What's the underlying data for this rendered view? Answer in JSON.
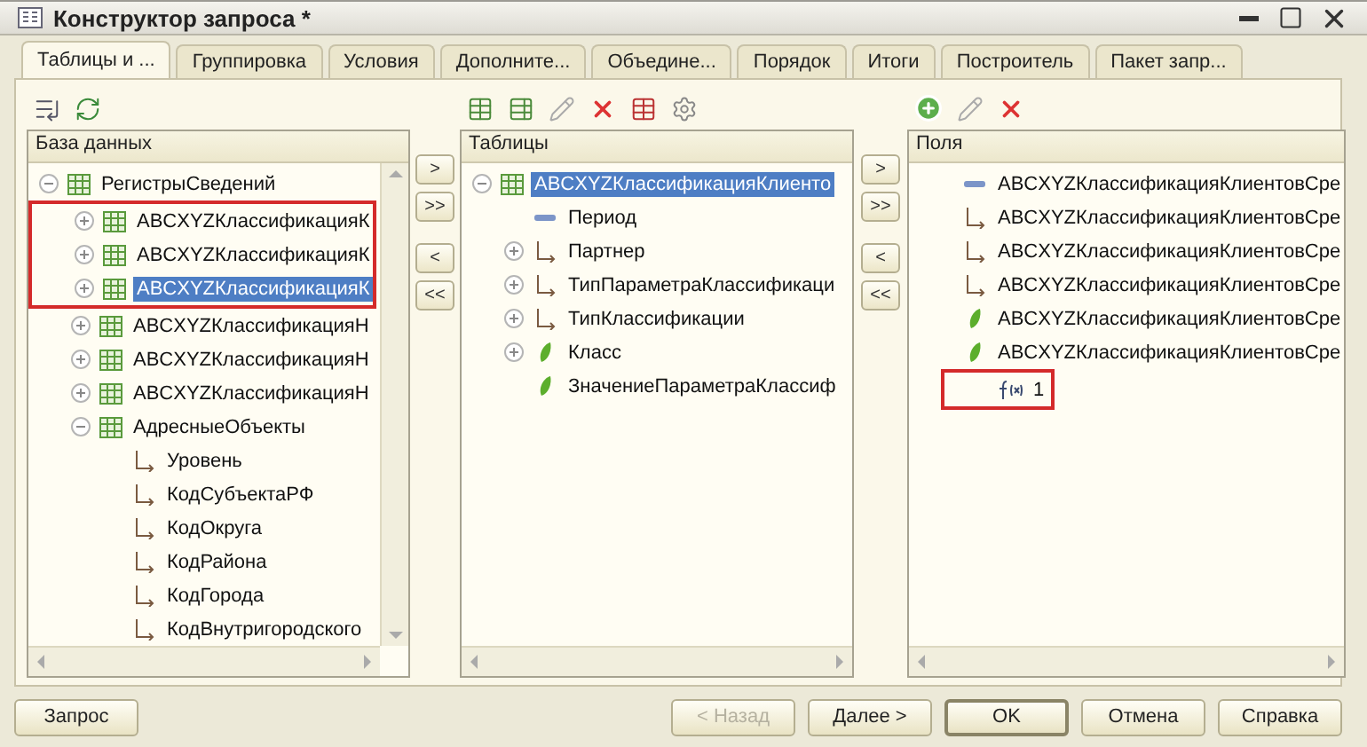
{
  "window": {
    "title": "Конструктор запроса *"
  },
  "tabs": [
    {
      "label": "Таблицы и ...",
      "selected": true
    },
    {
      "label": "Группировка",
      "selected": false
    },
    {
      "label": "Условия",
      "selected": false
    },
    {
      "label": "Дополните...",
      "selected": false
    },
    {
      "label": "Объедине...",
      "selected": false
    },
    {
      "label": "Порядок",
      "selected": false
    },
    {
      "label": "Итоги",
      "selected": false
    },
    {
      "label": "Построитель",
      "selected": false
    },
    {
      "label": "Пакет запр...",
      "selected": false
    }
  ],
  "database_panel": {
    "header": "База данных",
    "items": [
      {
        "label": "РегистрыСведений",
        "kind": "table",
        "expanded": true,
        "selected": false,
        "children": [
          {
            "label": "ABCXYZКлассификацияК",
            "kind": "table",
            "expanded": false,
            "selected": false,
            "marked": true
          },
          {
            "label": "ABCXYZКлассификацияК",
            "kind": "table",
            "expanded": false,
            "selected": false,
            "marked": true
          },
          {
            "label": "ABCXYZКлассификацияК",
            "kind": "table",
            "expanded": false,
            "selected": true,
            "marked": true
          },
          {
            "label": "ABCXYZКлассификацияН",
            "kind": "table",
            "expanded": false,
            "selected": false
          },
          {
            "label": "ABCXYZКлассификацияН",
            "kind": "table",
            "expanded": false,
            "selected": false
          },
          {
            "label": "ABCXYZКлассификацияН",
            "kind": "table",
            "expanded": false,
            "selected": false
          },
          {
            "label": "АдресныеОбъекты",
            "kind": "table",
            "expanded": true,
            "selected": false,
            "children": [
              {
                "label": "Уровень",
                "kind": "reference",
                "selected": false
              },
              {
                "label": "КодСубъектаРФ",
                "kind": "reference",
                "selected": false
              },
              {
                "label": "КодОкруга",
                "kind": "reference",
                "selected": false
              },
              {
                "label": "КодРайона",
                "kind": "reference",
                "selected": false
              },
              {
                "label": "КодГорода",
                "kind": "reference",
                "selected": false
              },
              {
                "label": "КодВнутригородского",
                "kind": "reference",
                "selected": false
              }
            ]
          }
        ]
      }
    ]
  },
  "move_buttons_left": [
    ">",
    ">>",
    "<",
    "<<"
  ],
  "tables_panel": {
    "header": "Таблицы",
    "items": [
      {
        "label": "ABCXYZКлассификацияКлиенто",
        "kind": "table",
        "expanded": true,
        "selected": true,
        "children": [
          {
            "label": "Период",
            "kind": "period",
            "selected": false
          },
          {
            "label": "Партнер",
            "kind": "reference",
            "expanded": false,
            "selected": false
          },
          {
            "label": "ТипПараметраКлассификаци",
            "kind": "reference",
            "expanded": false,
            "selected": false
          },
          {
            "label": "ТипКлассификации",
            "kind": "reference",
            "expanded": false,
            "selected": false
          },
          {
            "label": "Класс",
            "kind": "resource",
            "expanded": false,
            "selected": false
          },
          {
            "label": "ЗначениеПараметраКлассиф",
            "kind": "resource",
            "selected": false
          }
        ]
      }
    ]
  },
  "move_buttons_right": [
    ">",
    ">>",
    "<",
    "<<"
  ],
  "fields_panel": {
    "header": "Поля",
    "items": [
      {
        "label": "ABCXYZКлассификацияКлиентовСре",
        "kind": "period",
        "selected": false
      },
      {
        "label": "ABCXYZКлассификацияКлиентовСре",
        "kind": "reference",
        "selected": false
      },
      {
        "label": "ABCXYZКлассификацияКлиентовСре",
        "kind": "reference",
        "selected": false
      },
      {
        "label": "ABCXYZКлассификацияКлиентовСре",
        "kind": "reference",
        "selected": false
      },
      {
        "label": "ABCXYZКлассификацияКлиентовСре",
        "kind": "resource",
        "selected": false
      },
      {
        "label": "ABCXYZКлассификацияКлиентовСре",
        "kind": "resource",
        "selected": false
      },
      {
        "label": "1",
        "kind": "formula",
        "selected": false,
        "marked": true
      }
    ]
  },
  "footer_buttons": [
    {
      "label": "Запрос",
      "disabled": false,
      "default": false
    },
    {
      "label": "< Назад",
      "disabled": true,
      "default": false
    },
    {
      "label": "Далее >",
      "disabled": false,
      "default": false
    },
    {
      "label": "OK",
      "disabled": false,
      "default": true
    },
    {
      "label": "Отмена",
      "disabled": false,
      "default": false
    },
    {
      "label": "Справка",
      "disabled": false,
      "default": false
    }
  ]
}
